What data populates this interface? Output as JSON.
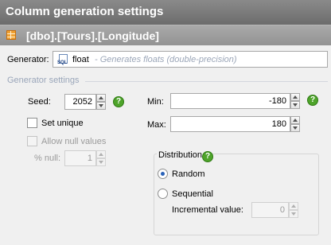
{
  "window": {
    "title": "Column generation settings"
  },
  "column": {
    "path": "[dbo].[Tours].[Longitude]"
  },
  "generator": {
    "label": "Generator:",
    "value": "float",
    "description": "- Generates floats (double-precision)"
  },
  "settings": {
    "group_title": "Generator settings",
    "seed": {
      "label": "Seed:",
      "value": "2052"
    },
    "set_unique": {
      "label": "Set unique",
      "checked": false
    },
    "allow_null": {
      "label": "Allow null values",
      "checked": false,
      "enabled": false
    },
    "pct_null": {
      "label": "% null:",
      "value": "1",
      "enabled": false
    },
    "min": {
      "label": "Min:",
      "value": "-180"
    },
    "max": {
      "label": "Max:",
      "value": "180"
    }
  },
  "distribution": {
    "title": "Distribution",
    "random_label": "Random",
    "sequential_label": "Sequential",
    "selected": "Random",
    "incremental": {
      "label": "Incremental value:",
      "value": "0",
      "enabled": false
    }
  },
  "icons": {
    "table": "table-icon",
    "sql": "sql-icon",
    "help": "help-icon",
    "help_glyph": "?"
  },
  "colors": {
    "title_bar": "#7a7a7a",
    "help_green": "#4ea42a",
    "group_title": "#9aa6ba"
  }
}
